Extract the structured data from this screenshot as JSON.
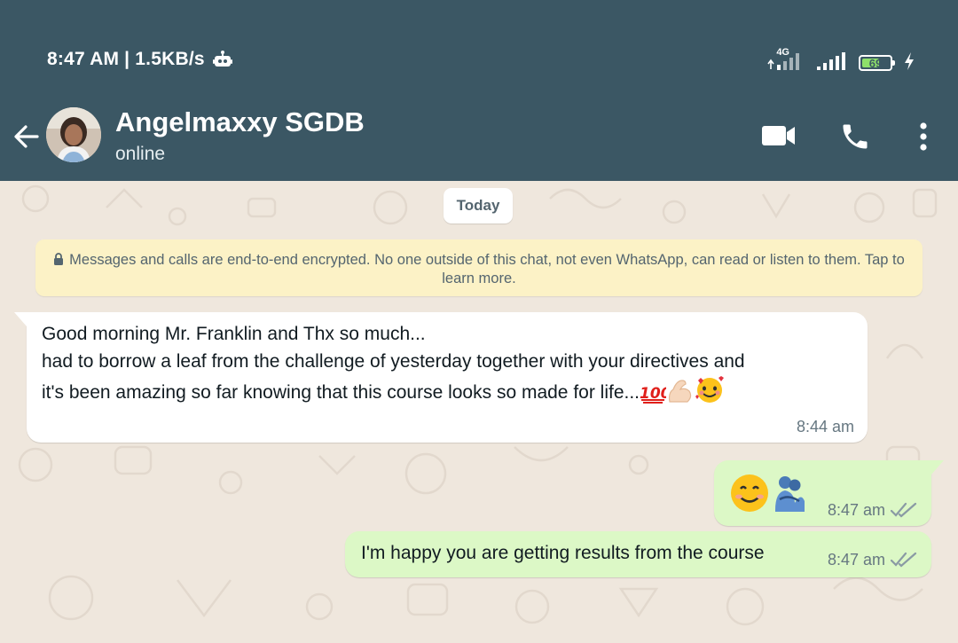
{
  "status_bar": {
    "time_speed": "8:47 AM | 1.5KB/s",
    "network_type": "4G",
    "battery_level": "69",
    "battery_fraction": 0.69,
    "icons": [
      "robot-icon",
      "signal-icon",
      "signal-icon",
      "battery-icon",
      "charging-icon"
    ]
  },
  "header": {
    "contact_name": "Angelmaxxy SGDB",
    "contact_status": "online",
    "icons": [
      "back-arrow-icon",
      "avatar",
      "video-call-icon",
      "voice-call-icon",
      "more-vert-icon"
    ]
  },
  "chat": {
    "date_chip": "Today",
    "encryption_notice": "Messages and calls are end-to-end encrypted. No one outside of this chat, not even WhatsApp, can read or listen to them. Tap to learn more.",
    "messages": [
      {
        "direction": "incoming",
        "text": "Good morning Mr. Franklin and Thx so much...\nhad to borrow a leaf from the challenge of yesterday together with your directives and\nit's been amazing so far knowing that this course looks so made for life...",
        "emojis": [
          "hundred-points-emoji",
          "flexed-biceps-emoji",
          "smiling-face-with-hearts-emoji"
        ],
        "time": "8:44 am"
      },
      {
        "direction": "outgoing",
        "text": "",
        "emojis": [
          "smiling-face-emoji",
          "people-hugging-emoji"
        ],
        "time": "8:47 am",
        "status": "read-double-tick"
      },
      {
        "direction": "outgoing",
        "text": "I'm happy you are getting results from the course",
        "time": "8:47 am",
        "status": "read-double-tick"
      }
    ]
  },
  "colors": {
    "header_bg": "#3b5764",
    "chat_bg": "#efe7dd",
    "incoming_bubble": "#ffffff",
    "outgoing_bubble": "#dcf8c6",
    "notice_bg": "#fcf2c6",
    "battery_green": "#8ee06a"
  }
}
